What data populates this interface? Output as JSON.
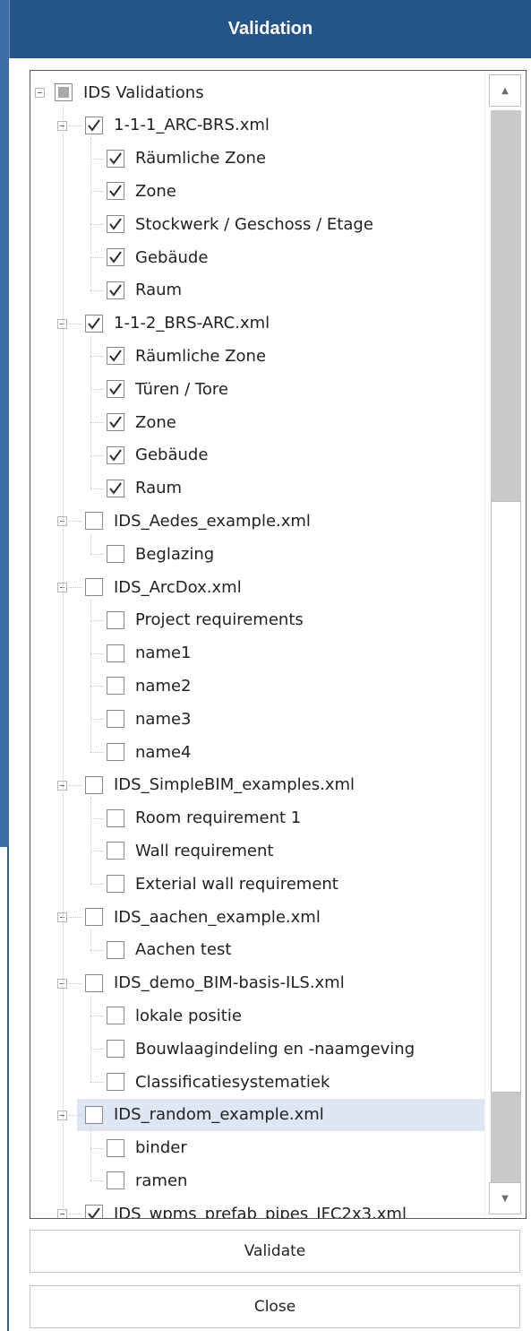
{
  "window": {
    "title": "Validation"
  },
  "tree": {
    "root": {
      "label": "IDS Validations",
      "state": "indeterminate"
    },
    "files": [
      {
        "label": "1-1-1_ARC-BRS.xml",
        "checked": true,
        "items": [
          {
            "label": "Räumliche Zone",
            "checked": true
          },
          {
            "label": "Zone",
            "checked": true
          },
          {
            "label": "Stockwerk / Geschoss / Etage",
            "checked": true
          },
          {
            "label": "Gebäude",
            "checked": true
          },
          {
            "label": "Raum",
            "checked": true
          }
        ]
      },
      {
        "label": "1-1-2_BRS-ARC.xml",
        "checked": true,
        "items": [
          {
            "label": "Räumliche Zone",
            "checked": true
          },
          {
            "label": "Türen / Tore",
            "checked": true
          },
          {
            "label": "Zone",
            "checked": true
          },
          {
            "label": "Gebäude",
            "checked": true
          },
          {
            "label": "Raum",
            "checked": true
          }
        ]
      },
      {
        "label": "IDS_Aedes_example.xml",
        "checked": false,
        "items": [
          {
            "label": "Beglazing",
            "checked": false
          }
        ]
      },
      {
        "label": "IDS_ArcDox.xml",
        "checked": false,
        "items": [
          {
            "label": "Project requirements",
            "checked": false
          },
          {
            "label": "name1",
            "checked": false
          },
          {
            "label": "name2",
            "checked": false
          },
          {
            "label": "name3",
            "checked": false
          },
          {
            "label": "name4",
            "checked": false
          }
        ]
      },
      {
        "label": "IDS_SimpleBIM_examples.xml",
        "checked": false,
        "items": [
          {
            "label": "Room requirement 1",
            "checked": false
          },
          {
            "label": "Wall requirement",
            "checked": false
          },
          {
            "label": "Exterial wall requirement",
            "checked": false
          }
        ]
      },
      {
        "label": "IDS_aachen_example.xml",
        "checked": false,
        "items": [
          {
            "label": "Aachen test",
            "checked": false
          }
        ]
      },
      {
        "label": "IDS_demo_BIM-basis-ILS.xml",
        "checked": false,
        "items": [
          {
            "label": "lokale positie",
            "checked": false
          },
          {
            "label": "Bouwlaagindeling en -naamgeving",
            "checked": false
          },
          {
            "label": "Classificatiesystematiek",
            "checked": false
          }
        ]
      },
      {
        "label": "IDS_random_example.xml",
        "checked": false,
        "selected": true,
        "items": [
          {
            "label": "binder",
            "checked": false
          },
          {
            "label": "ramen",
            "checked": false
          }
        ]
      },
      {
        "label": "IDS_wpms_prefab_pipes_IFC2x3.xml",
        "checked": true,
        "items": []
      }
    ]
  },
  "scrollbar": {
    "up_icon": "triangle-up-icon",
    "down_icon": "triangle-down-icon"
  },
  "buttons": {
    "validate": "Validate",
    "close": "Close"
  },
  "colors": {
    "title_bar": "#255489",
    "selection": "#dde6f2",
    "scroll_track": "#c9c9c9"
  }
}
